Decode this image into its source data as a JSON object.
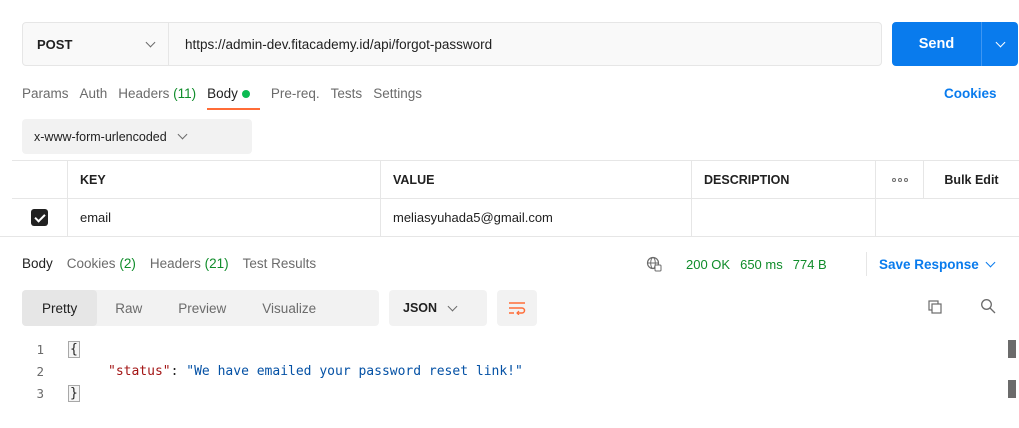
{
  "request": {
    "method": "POST",
    "url": "https://admin-dev.fitacademy.id/api/forgot-password",
    "send_label": "Send"
  },
  "request_tabs": [
    {
      "label": "Params"
    },
    {
      "label": "Auth"
    },
    {
      "label": "Headers",
      "count": "(11)"
    },
    {
      "label": "Body",
      "active": true
    },
    {
      "label": "Pre-req."
    },
    {
      "label": "Tests"
    },
    {
      "label": "Settings"
    }
  ],
  "cookies_link": "Cookies",
  "body_type": "x-www-form-urlencoded",
  "table": {
    "headers": {
      "key": "KEY",
      "value": "VALUE",
      "description": "DESCRIPTION",
      "bulk_edit": "Bulk Edit"
    },
    "rows": [
      {
        "checked": true,
        "key": "email",
        "value": "meliasyuhada5@gmail.com",
        "description": ""
      }
    ]
  },
  "response_tabs": [
    {
      "label": "Body",
      "active": true
    },
    {
      "label": "Cookies",
      "count": "(2)"
    },
    {
      "label": "Headers",
      "count": "(21)"
    },
    {
      "label": "Test Results"
    }
  ],
  "status": {
    "code": "200 OK",
    "time": "650 ms",
    "size": "774 B"
  },
  "save_response": "Save Response",
  "view_tabs": [
    "Pretty",
    "Raw",
    "Preview",
    "Visualize"
  ],
  "format": "JSON",
  "code": {
    "line_numbers": [
      "1",
      "2",
      "3"
    ],
    "open_brace": "{",
    "close_brace": "}",
    "key": "\"status\"",
    "colon": ": ",
    "value": "\"We have emailed your password reset link!\""
  },
  "colors": {
    "accent": "#ff6c37",
    "primary": "#097bed",
    "success": "#0f8c2a"
  }
}
